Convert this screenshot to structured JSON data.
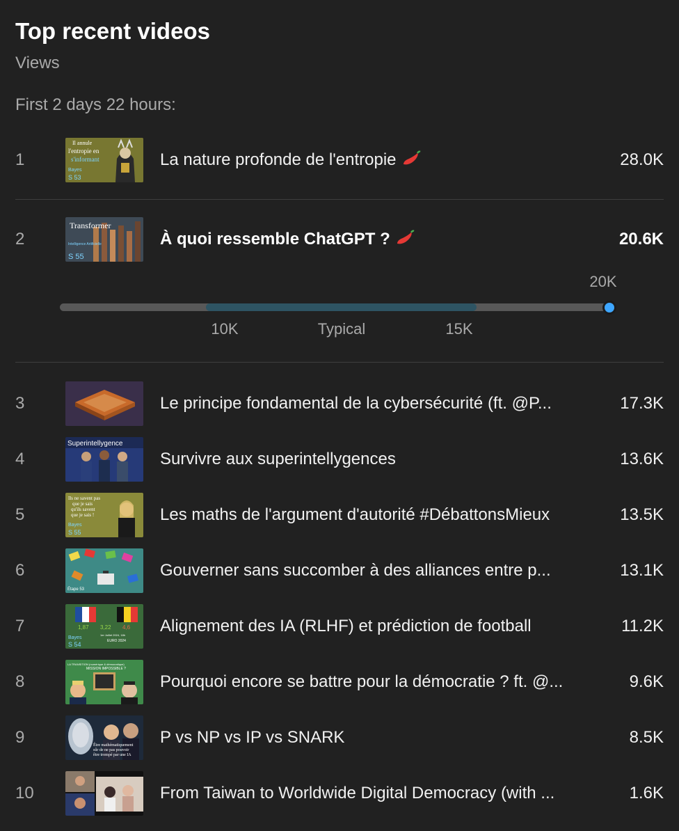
{
  "header": {
    "title": "Top recent videos",
    "subtitle": "Views",
    "period": "First 2 days 22 hours:"
  },
  "videos": [
    {
      "rank": "1",
      "title": "La nature profonde de l'entropie",
      "views": "28.0K",
      "spicy": true,
      "thumb_text": [
        "Il annule",
        "l'entropie en",
        "s'informant",
        "Bayes",
        "S 53"
      ]
    },
    {
      "rank": "2",
      "title": "À quoi ressemble ChatGPT ?",
      "views": "20.6K",
      "spicy": true,
      "thumb_text": [
        "Transformer",
        "Intelligence Artificielle",
        "S 55"
      ]
    },
    {
      "rank": "3",
      "title": "Le principe fondamental de la cybersécurité (ft. @P...",
      "views": "17.3K",
      "spicy": false,
      "thumb_text": []
    },
    {
      "rank": "4",
      "title": "Survivre aux superintellygences",
      "views": "13.6K",
      "spicy": false,
      "thumb_text": [
        "Superintellygence"
      ]
    },
    {
      "rank": "5",
      "title": "Les maths de l'argument d'autorité #DébattonsMieux",
      "views": "13.5K",
      "spicy": false,
      "thumb_text": [
        "Ils ne savent pas",
        "que je sais",
        "qu'ils savent",
        "que je sais !",
        "Bayes",
        "S 55"
      ]
    },
    {
      "rank": "6",
      "title": "Gouverner sans succomber à des alliances entre p...",
      "views": "13.1K",
      "spicy": false,
      "thumb_text": [
        "Étape 53"
      ]
    },
    {
      "rank": "7",
      "title": "Alignement des IA (RLHF) et prédiction de football",
      "views": "11.2K",
      "spicy": false,
      "thumb_text": [
        "1,87",
        "3,22",
        "4,6",
        "1er Juillet 2024, 18h",
        "EURO 2024",
        "Bayes",
        "S 54"
      ]
    },
    {
      "rank": "8",
      "title": "Pourquoi encore se battre pour la démocratie ? ft. @...",
      "views": "9.6K",
      "spicy": false,
      "thumb_text": [
        "LA TRANSITION (numérique & démocratique)",
        "MISSION IMPOSSIBLE ?"
      ]
    },
    {
      "rank": "9",
      "title": "P vs NP vs IP vs SNARK",
      "views": "8.5K",
      "spicy": false,
      "thumb_text": [
        "Être mathématiquement",
        "sûr de ne pas pouvoir",
        "être trompé par une IA"
      ]
    },
    {
      "rank": "10",
      "title": "From Taiwan to Worldwide Digital Democracy (with ...",
      "views": "1.6K",
      "spicy": false,
      "thumb_text": []
    }
  ],
  "benchmark": {
    "typical_label": "Typical",
    "typical_low_label": "10K",
    "typical_high_label": "15K",
    "current_label": "20K",
    "typical_range": [
      10000,
      15000
    ],
    "current_value": 20600,
    "colors": {
      "track": "#585858",
      "typical": "#2e5463",
      "dot": "#3ea6ff"
    }
  },
  "colors": {
    "background": "#212121",
    "text": "#f1f1f1",
    "muted": "#aaaaaa",
    "accent": "#3ea6ff"
  }
}
